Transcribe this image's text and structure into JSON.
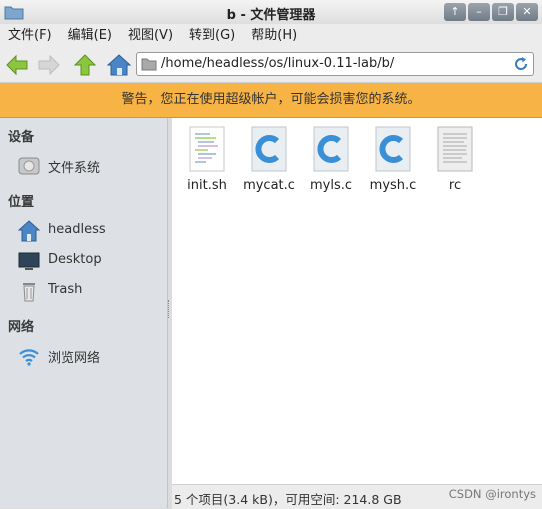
{
  "window": {
    "title": "b - 文件管理器",
    "controls": [
      "↑",
      "–",
      "❐",
      "✕"
    ]
  },
  "menu": [
    "文件(F)",
    "编辑(E)",
    "视图(V)",
    "转到(G)",
    "帮助(H)"
  ],
  "toolbar": {
    "buttons": [
      "back-arrow-icon",
      "forward-arrow-icon",
      "up-arrow-icon",
      "home-icon"
    ],
    "path": "/home/headless/os/linux-0.11-lab/b/"
  },
  "warning": "警告，您正在使用超级帐户，可能会损害您的系统。",
  "sidebar": {
    "devices_heading": "设备",
    "filesystem": "文件系统",
    "places_heading": "位置",
    "places": [
      {
        "label": "headless",
        "icon": "home-icon"
      },
      {
        "label": "Desktop",
        "icon": "desktop-icon"
      },
      {
        "label": "Trash",
        "icon": "trash-icon"
      }
    ],
    "network_heading": "网络",
    "network_browse": "浏览网络"
  },
  "files": [
    {
      "name": "init.sh",
      "icon": "script-file-icon"
    },
    {
      "name": "mycat.c",
      "icon": "c-source-icon"
    },
    {
      "name": "myls.c",
      "icon": "c-source-icon"
    },
    {
      "name": "mysh.c",
      "icon": "c-source-icon"
    },
    {
      "name": "rc",
      "icon": "text-file-icon"
    }
  ],
  "status": "5 个项目(3.4 kB)，可用空间: 214.8 GB",
  "watermark": "CSDN @irontys",
  "colors": {
    "warning_bg": "#f7b343",
    "sidebar_bg": "#dde1e5",
    "c_icon": "#3a8fd6"
  }
}
